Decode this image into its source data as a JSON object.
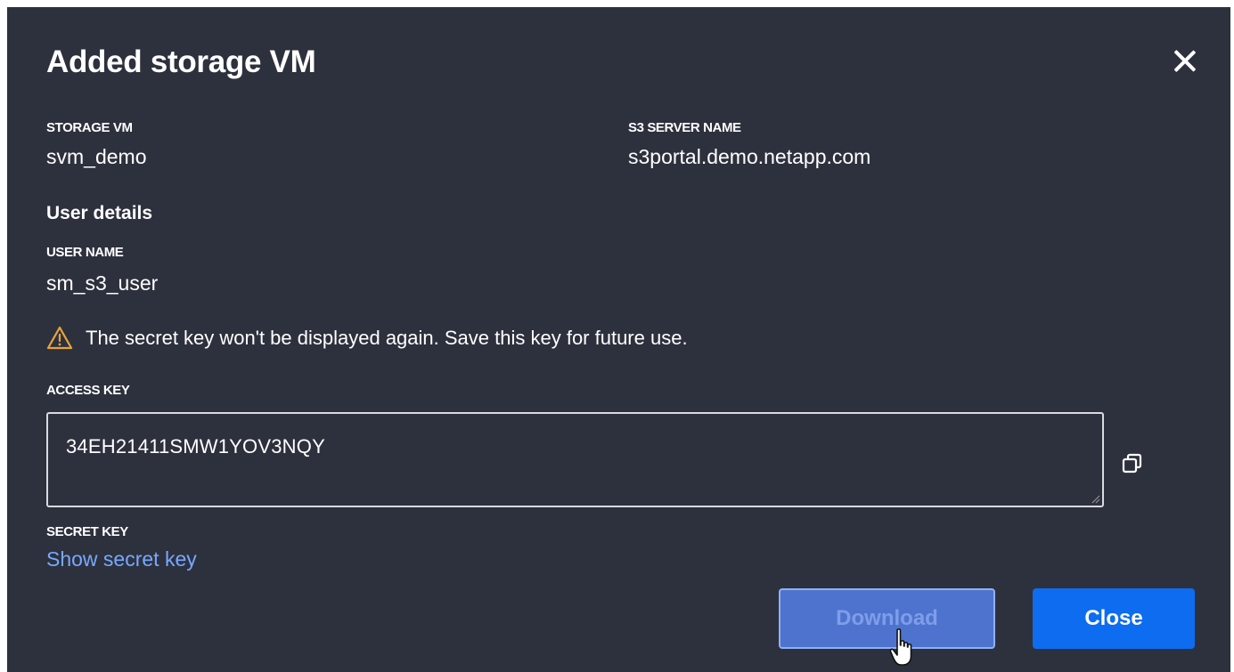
{
  "dialog": {
    "title": "Added storage VM",
    "close_icon": "close-icon"
  },
  "storage_vm": {
    "label": "STORAGE VM",
    "value": "svm_demo"
  },
  "s3_server": {
    "label": "S3 SERVER NAME",
    "value": "s3portal.demo.netapp.com"
  },
  "user_details": {
    "title": "User details",
    "user_name_label": "USER NAME",
    "user_name_value": "sm_s3_user"
  },
  "warning": {
    "icon": "warning-triangle-icon",
    "text": "The secret key won't be displayed again. Save this key for future use."
  },
  "access_key": {
    "label": "ACCESS KEY",
    "value": "34EH21411SMW1YOV3NQY",
    "copy_icon": "copy-icon"
  },
  "secret_key": {
    "label": "SECRET KEY",
    "link_text": "Show secret key"
  },
  "buttons": {
    "download": "Download",
    "close": "Close"
  },
  "colors": {
    "dialog_bg": "#2d313d",
    "link": "#78a8ff",
    "primary": "#0e6cf0",
    "download_bg": "#4e73cf"
  }
}
